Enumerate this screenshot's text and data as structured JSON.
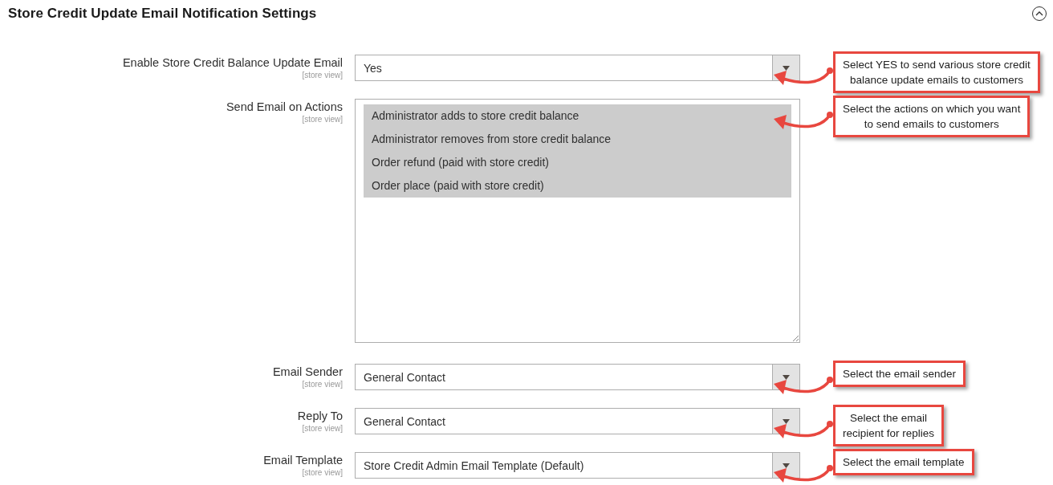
{
  "section": {
    "title": "Store Credit Update Email Notification Settings",
    "expanded": true
  },
  "fields": [
    {
      "kind": "select",
      "label": "Enable Store Credit Balance Update Email",
      "scope": "[store view]",
      "value": "Yes",
      "callout": [
        "Select YES to send various store credit",
        "balance update emails to customers"
      ]
    },
    {
      "kind": "multiselect",
      "label": "Send Email on Actions",
      "scope": "[store view]",
      "options": [
        {
          "label": "Administrator adds to store credit balance",
          "selected": true
        },
        {
          "label": "Administrator removes from store credit balance",
          "selected": true
        },
        {
          "label": "Order refund (paid with store credit)",
          "selected": true
        },
        {
          "label": "Order place (paid with store credit)",
          "selected": true
        }
      ],
      "callout": [
        "Select the actions on which you want",
        "to send emails to customers"
      ]
    },
    {
      "kind": "select",
      "label": "Email Sender",
      "scope": "[store view]",
      "value": "General Contact",
      "callout": [
        "Select the email sender"
      ]
    },
    {
      "kind": "select",
      "label": "Reply To",
      "scope": "[store view]",
      "value": "General Contact",
      "callout": [
        "Select the email",
        "recipient for replies"
      ]
    },
    {
      "kind": "select",
      "label": "Email Template",
      "scope": "[store view]",
      "value": "Store Credit Admin Email Template (Default)",
      "callout": [
        "Select the email template"
      ]
    }
  ]
}
